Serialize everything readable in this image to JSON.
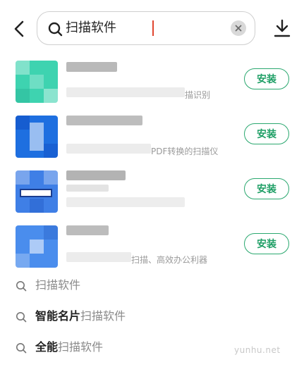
{
  "search": {
    "value": "扫描软件"
  },
  "apps": [
    {
      "desc": "描识别",
      "install_label": "安装"
    },
    {
      "desc": "PDF转换的扫描仪",
      "install_label": "安装"
    },
    {
      "desc": "",
      "install_label": "安装"
    },
    {
      "desc": "扫描、高效办公利器",
      "install_label": "安装"
    }
  ],
  "suggestions": [
    {
      "prefix": "",
      "match": "扫描软件"
    },
    {
      "prefix": "智能名片",
      "match": "扫描软件"
    },
    {
      "prefix": "全能",
      "match": "扫描软件"
    }
  ],
  "watermark": "yunhu.net",
  "colors": {
    "accent_green": "#1f9f66",
    "caret": "#e0452f"
  }
}
